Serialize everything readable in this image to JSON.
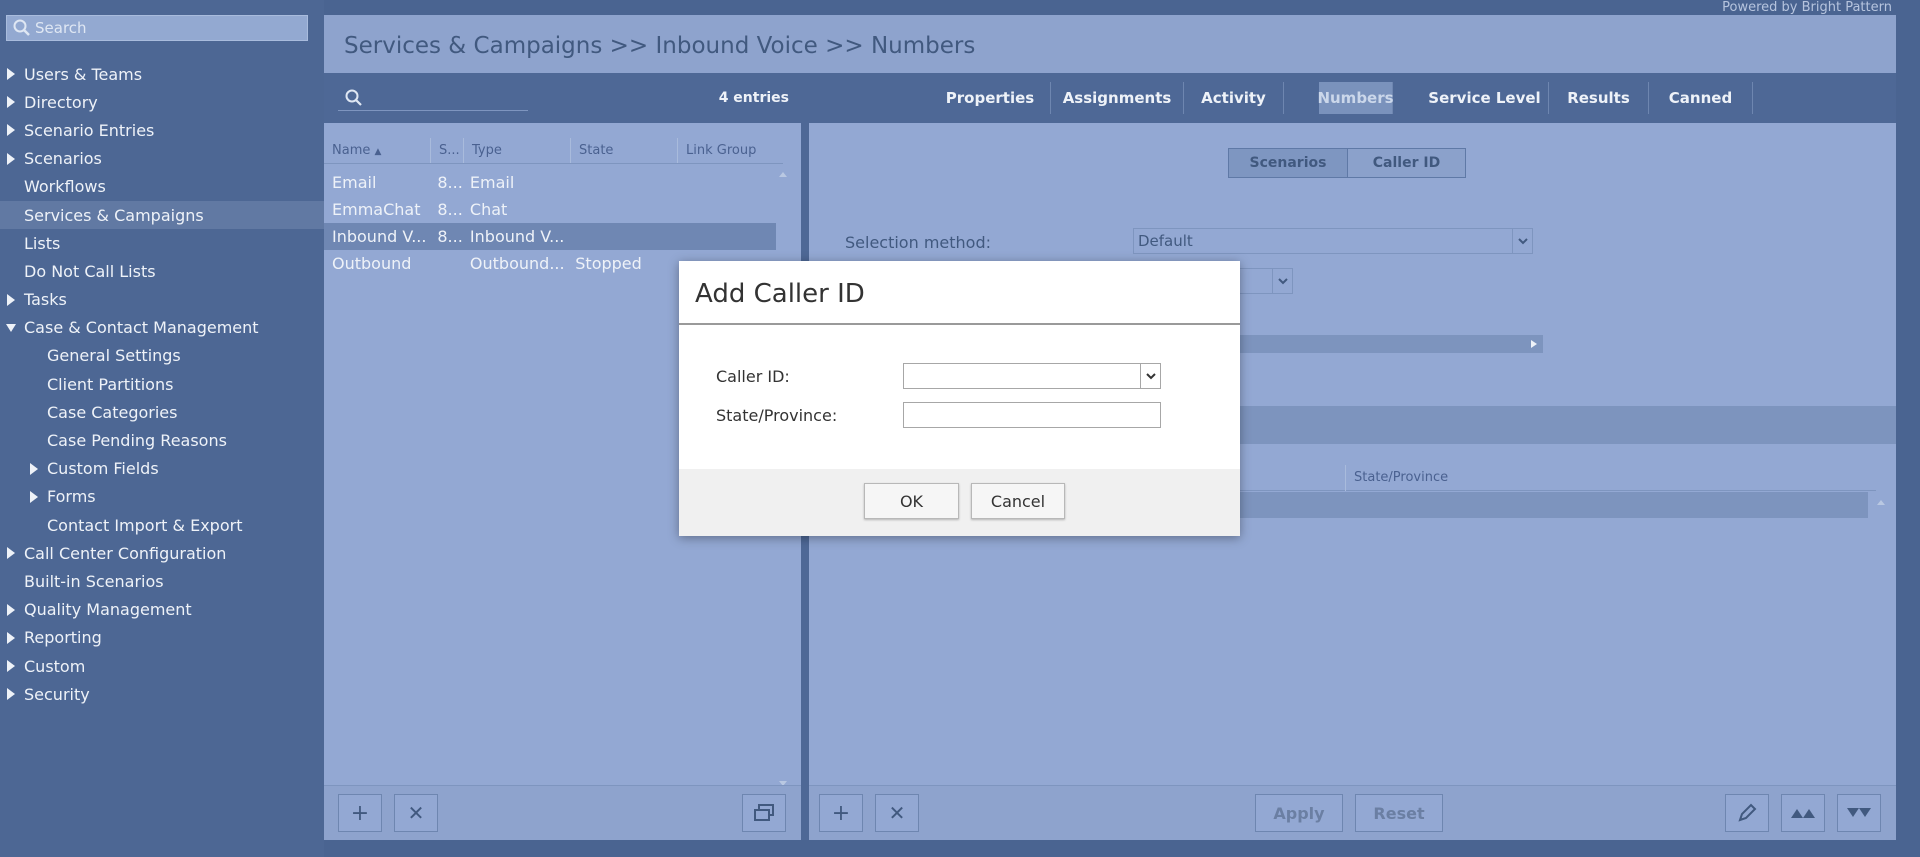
{
  "brand": {
    "powered_by": "Powered by Bright Pattern"
  },
  "sidebar": {
    "search_placeholder": "Search",
    "items": [
      {
        "label": "Users & Teams",
        "expandable": true,
        "expanded": false,
        "level": 1
      },
      {
        "label": "Directory",
        "expandable": true,
        "expanded": false,
        "level": 1
      },
      {
        "label": "Scenario Entries",
        "expandable": true,
        "expanded": false,
        "level": 1
      },
      {
        "label": "Scenarios",
        "expandable": true,
        "expanded": false,
        "level": 1
      },
      {
        "label": "Workflows",
        "expandable": false,
        "level": 1
      },
      {
        "label": "Services & Campaigns",
        "expandable": false,
        "level": 1,
        "selected": true
      },
      {
        "label": "Lists",
        "expandable": false,
        "level": 1
      },
      {
        "label": "Do Not Call Lists",
        "expandable": false,
        "level": 1
      },
      {
        "label": "Tasks",
        "expandable": true,
        "expanded": false,
        "level": 1
      },
      {
        "label": "Case & Contact Management",
        "expandable": true,
        "expanded": true,
        "level": 1
      },
      {
        "label": "General Settings",
        "expandable": false,
        "level": 2
      },
      {
        "label": "Client Partitions",
        "expandable": false,
        "level": 2
      },
      {
        "label": "Case Categories",
        "expandable": false,
        "level": 2
      },
      {
        "label": "Case Pending Reasons",
        "expandable": false,
        "level": 2
      },
      {
        "label": "Custom Fields",
        "expandable": true,
        "expanded": false,
        "level": 2
      },
      {
        "label": "Forms",
        "expandable": true,
        "expanded": false,
        "level": 2
      },
      {
        "label": "Contact Import & Export",
        "expandable": false,
        "level": 2
      },
      {
        "label": "Call Center Configuration",
        "expandable": true,
        "expanded": false,
        "level": 1
      },
      {
        "label": "Built-in Scenarios",
        "expandable": false,
        "level": 1
      },
      {
        "label": "Quality Management",
        "expandable": true,
        "expanded": false,
        "level": 1
      },
      {
        "label": "Reporting",
        "expandable": true,
        "expanded": false,
        "level": 1
      },
      {
        "label": "Custom",
        "expandable": true,
        "expanded": false,
        "level": 1
      },
      {
        "label": "Security",
        "expandable": true,
        "expanded": false,
        "level": 1
      }
    ]
  },
  "page": {
    "title": "Services & Campaigns >> Inbound Voice >> Numbers"
  },
  "list": {
    "entries": "4 entries",
    "columns": [
      "Name",
      "S...",
      "Type",
      "State",
      "Link Group"
    ],
    "rows": [
      {
        "name": "Email",
        "s": "8...",
        "type": "Email",
        "state": "",
        "link": ""
      },
      {
        "name": "EmmaChat",
        "s": "8...",
        "type": "Chat",
        "state": "",
        "link": ""
      },
      {
        "name": "Inbound V...",
        "s": "8...",
        "type": "Inbound V...",
        "state": "",
        "link": "",
        "selected": true
      },
      {
        "name": "Outbound",
        "s": "",
        "type": "Outbound...",
        "state": "Stopped",
        "link": ""
      }
    ]
  },
  "detail": {
    "tabs": [
      "Properties",
      "Assignments",
      "Activity",
      "Numbers",
      "Service Level",
      "Results",
      "Canned"
    ],
    "active_tab": "Numbers",
    "crumbs": [
      "Scenarios",
      "Caller ID"
    ],
    "selection_method_label": "Selection method:",
    "selection_method_value": "Default",
    "grid_col_state": "State/Province",
    "buttons": {
      "apply": "Apply",
      "reset": "Reset"
    }
  },
  "modal": {
    "title": "Add Caller ID",
    "caller_id_label": "Caller ID:",
    "caller_id_value": "",
    "state_label": "State/Province:",
    "state_value": "",
    "ok": "OK",
    "cancel": "Cancel"
  },
  "colors": {
    "sidebar_bg": "#4d6794",
    "panel_bg": "#93a8d3",
    "accent_dark": "#4e6896"
  }
}
